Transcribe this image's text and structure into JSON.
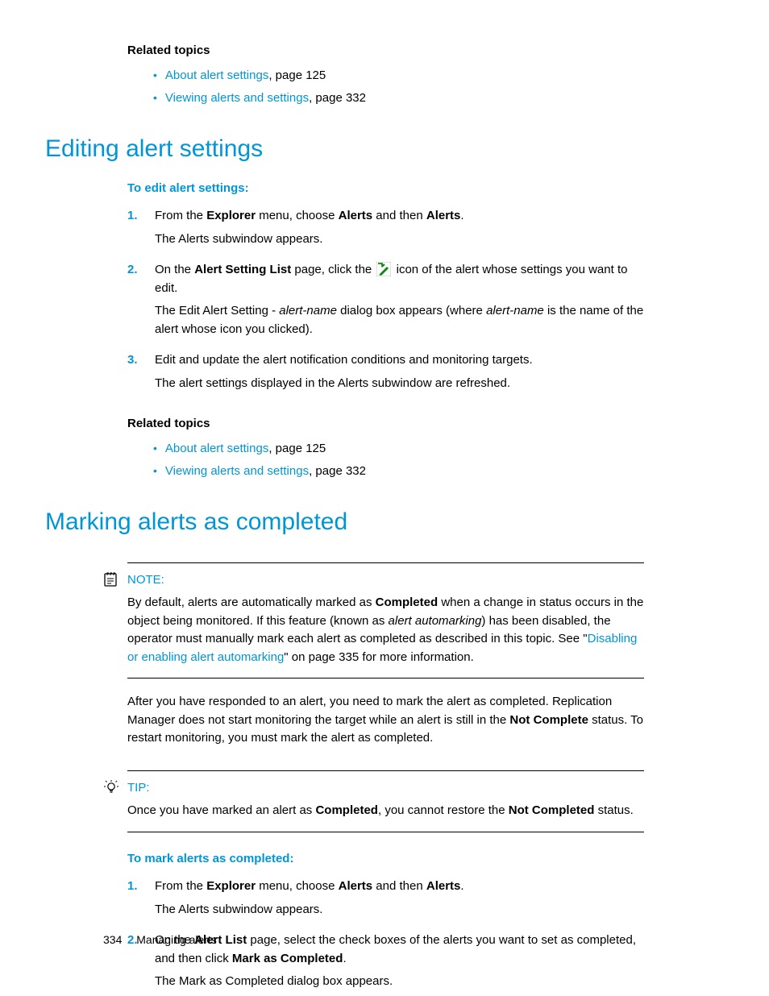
{
  "related1": {
    "heading": "Related topics",
    "items": [
      {
        "link": "About alert settings",
        "suffix": ", page 125"
      },
      {
        "link": "Viewing alerts and settings",
        "suffix": ", page 332"
      }
    ]
  },
  "section1": {
    "heading": "Editing alert settings",
    "procHeading": "To edit alert settings:",
    "steps": [
      {
        "n": "1.",
        "line1_a": "From the ",
        "line1_b": "Explorer",
        "line1_c": " menu, choose ",
        "line1_d": "Alerts",
        "line1_e": " and then ",
        "line1_f": "Alerts",
        "line1_g": ".",
        "line2": "The Alerts subwindow appears."
      },
      {
        "n": "2.",
        "line1_a": "On the ",
        "line1_b": "Alert Setting List",
        "line1_c": " page, click the ",
        "line1_d": " icon of the alert whose settings you want to edit.",
        "line2_a": "The Edit Alert Setting - ",
        "line2_b": "alert-name",
        "line2_c": " dialog box appears (where ",
        "line2_d": "alert-name",
        "line2_e": " is the name of the alert whose icon you clicked)."
      },
      {
        "n": "3.",
        "line1": "Edit and update the alert notification conditions and monitoring targets.",
        "line2": "The alert settings displayed in the Alerts subwindow are refreshed."
      }
    ]
  },
  "related2": {
    "heading": "Related topics",
    "items": [
      {
        "link": "About alert settings",
        "suffix": ", page 125"
      },
      {
        "link": "Viewing alerts and settings",
        "suffix": ", page 332"
      }
    ]
  },
  "section2": {
    "heading": "Marking alerts as completed",
    "note": {
      "label": "NOTE:",
      "t1": "By default, alerts are automatically marked as ",
      "t2": "Completed",
      "t3": " when a change in status occurs in the object being monitored. If this feature (known as ",
      "t4": "alert automarking",
      "t5": ") has been disabled, the operator must manually mark each alert as completed as described in this topic. See \"",
      "link": "Disabling or enabling alert automarking",
      "t6": "\" on page 335 for more information."
    },
    "para_a": "After you have responded to an alert, you need to mark the alert as completed. Replication Manager does not start monitoring the target while an alert is still in the ",
    "para_b": "Not Complete",
    "para_c": " status. To restart monitoring, you must mark the alert as completed.",
    "tip": {
      "label": "TIP:",
      "t1": "Once you have marked an alert as ",
      "t2": "Completed",
      "t3": ", you cannot restore the ",
      "t4": "Not Completed",
      "t5": " status."
    },
    "procHeading": "To mark alerts as completed:",
    "steps": [
      {
        "n": "1.",
        "line1_a": "From the ",
        "line1_b": "Explorer",
        "line1_c": " menu, choose ",
        "line1_d": "Alerts",
        "line1_e": " and then ",
        "line1_f": "Alerts",
        "line1_g": ".",
        "line2": "The Alerts subwindow appears."
      },
      {
        "n": "2.",
        "line1_a": "On the ",
        "line1_b": "Alert List",
        "line1_c": " page, select the check boxes of the alerts you want to set as completed, and then click ",
        "line1_d": "Mark as Completed",
        "line1_e": ".",
        "line2": "The Mark as Completed dialog box appears."
      }
    ]
  },
  "footer": {
    "page": "334",
    "chapter": "Managing alerts"
  }
}
